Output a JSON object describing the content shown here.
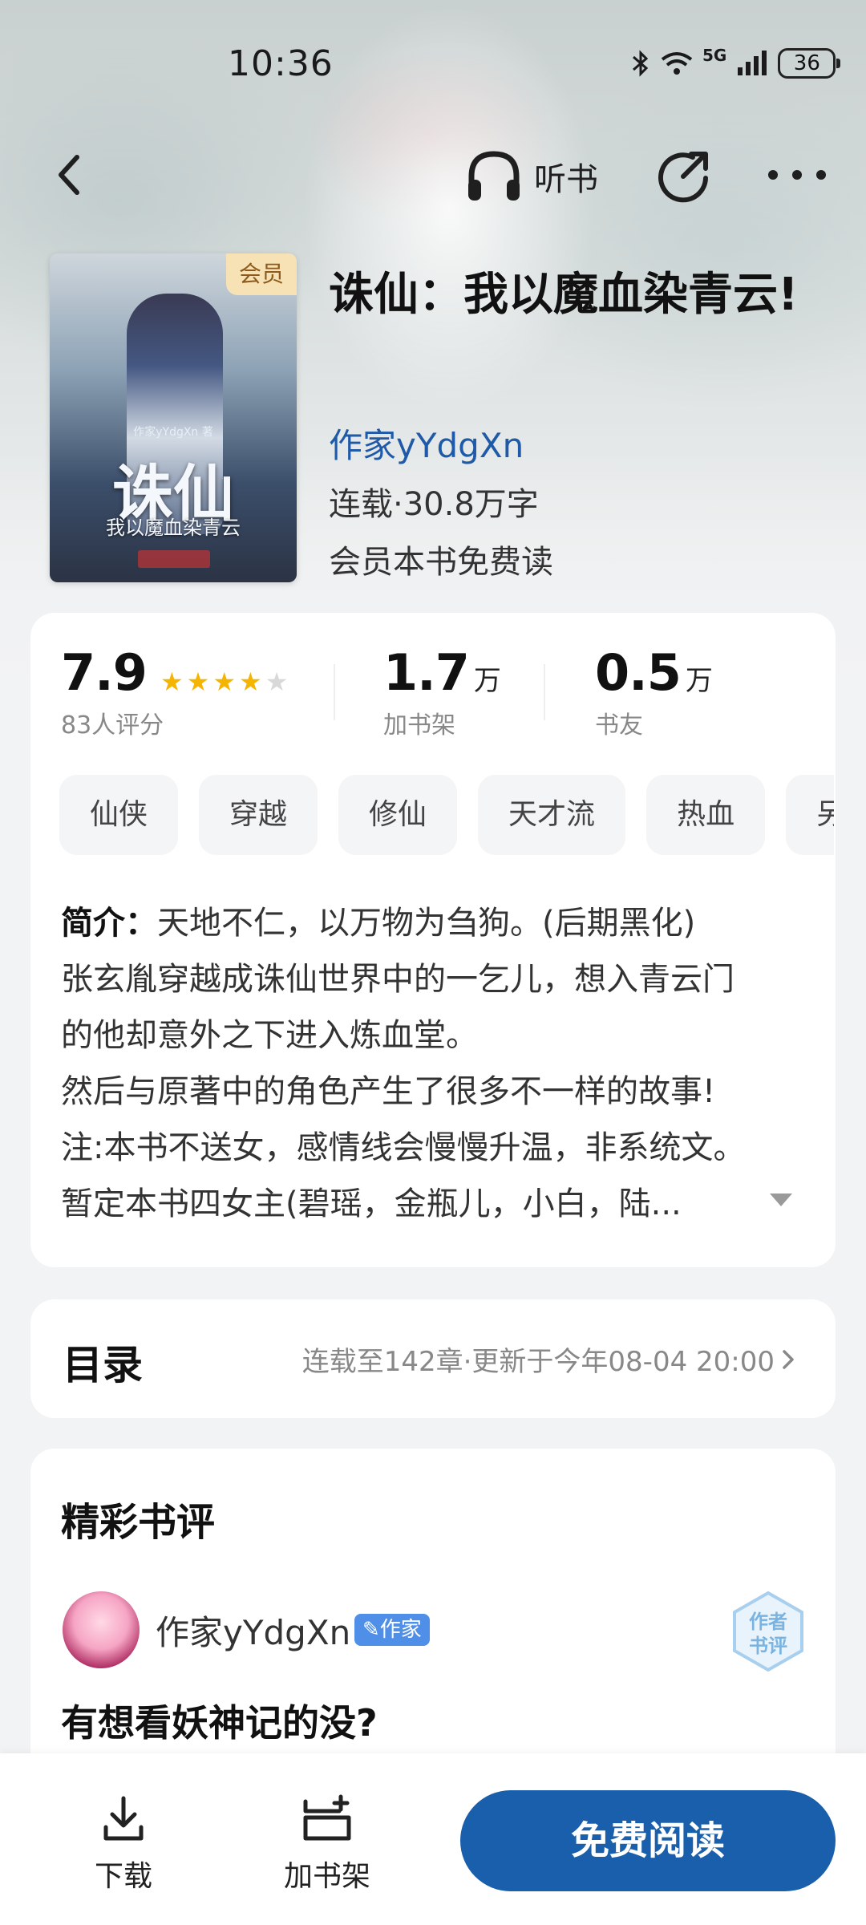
{
  "status_bar": {
    "time": "10:36",
    "network": "5G",
    "battery": "36",
    "icons": [
      "bluetooth-icon",
      "wifi-icon",
      "signal-icon",
      "battery-icon"
    ]
  },
  "top_nav": {
    "listen_label": "听书",
    "icons": [
      "back-icon",
      "headphones-icon",
      "share-icon",
      "more-icon"
    ]
  },
  "book": {
    "cover_title": "诛仙",
    "cover_subtitle": "我以魔血染青云",
    "cover_author": "作家yYdgXn 著",
    "vip_badge": "会员",
    "title": "诛仙：我以魔血染青云!",
    "author": "作家yYdgXn",
    "status": "连载·30.8万字",
    "vip_free": "会员本书免费读"
  },
  "stats": {
    "rating": "7.9",
    "rating_stars": 4,
    "rating_stars_max": 5,
    "rating_count": "83人评分",
    "shelf_value": "1.7",
    "shelf_unit": "万",
    "shelf_label": "加书架",
    "fans_value": "0.5",
    "fans_unit": "万",
    "fans_label": "书友"
  },
  "tags": [
    "仙侠",
    "穿越",
    "修仙",
    "天才流",
    "热血",
    "另"
  ],
  "intro": {
    "label": "简介：",
    "lines": [
      "天地不仁，以万物为刍狗。(后期黑化)",
      "张玄胤穿越成诛仙世界中的一乞儿，想入青云门",
      "的他却意外之下进入炼血堂。",
      "然后与原著中的角色产生了很多不一样的故事!",
      "注:本书不送女，感情线会慢慢升温，非系统文。",
      "暂定本书四女主(碧瑶，金瓶儿，小白，陆..."
    ]
  },
  "toc": {
    "title": "目录",
    "meta": "连载至142章·更新于今年08-04 20:00"
  },
  "reviews": {
    "heading": "精彩书评",
    "reviewer": "作家yYdgXn",
    "reviewer_tag": "作家",
    "stamp_text_top": "作者",
    "stamp_text_bottom": "书评",
    "review_title": "有想看妖神记的没?"
  },
  "bottom_bar": {
    "download_label": "下载",
    "add_shelf_label": "加书架",
    "read_button": "免费阅读"
  },
  "colors": {
    "accent": "#1a5fab",
    "author_link": "#1e5aa8",
    "star": "#f5b400",
    "vip_badge_bg": "#f6e2b4"
  }
}
